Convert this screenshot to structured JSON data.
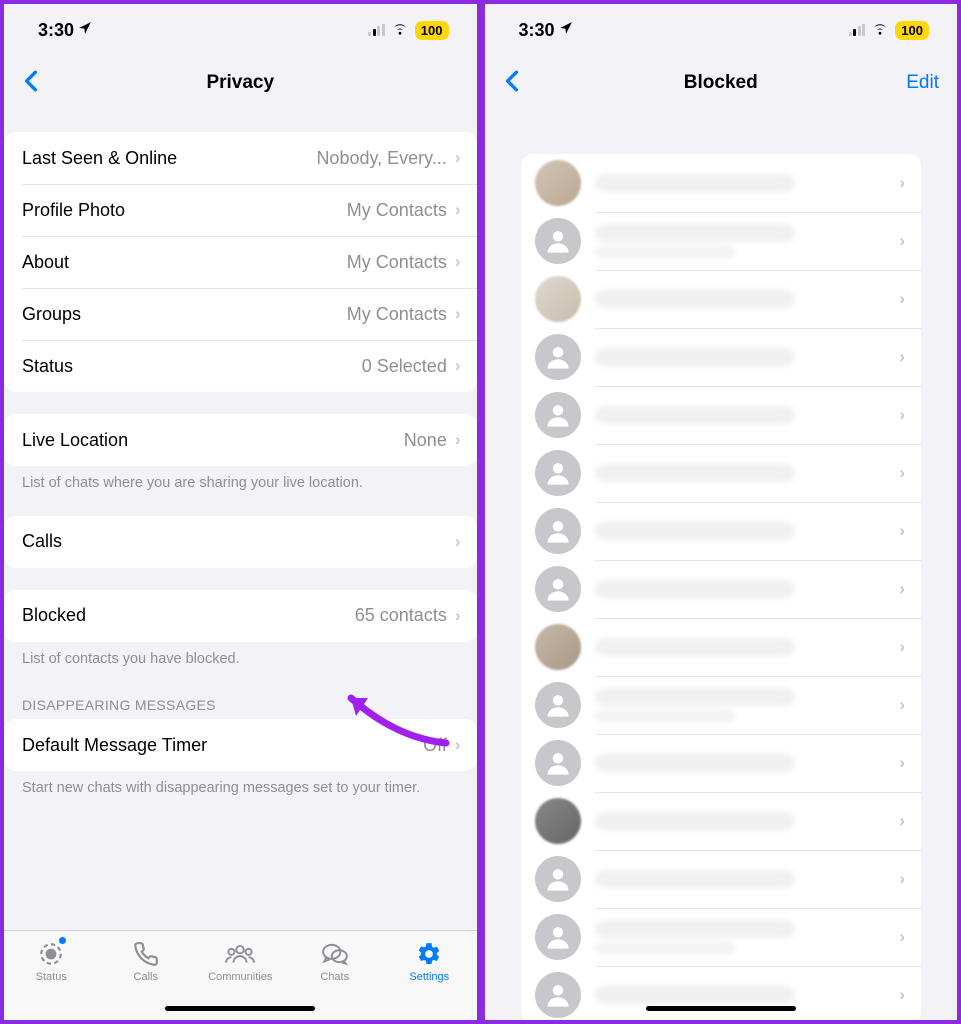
{
  "status_bar": {
    "time": "3:30",
    "battery": "100"
  },
  "left": {
    "title": "Privacy",
    "groups": {
      "g1": [
        {
          "label": "Last Seen & Online",
          "value": "Nobody, Every..."
        },
        {
          "label": "Profile Photo",
          "value": "My Contacts"
        },
        {
          "label": "About",
          "value": "My Contacts"
        },
        {
          "label": "Groups",
          "value": "My Contacts"
        },
        {
          "label": "Status",
          "value": "0 Selected"
        }
      ],
      "g2": [
        {
          "label": "Live Location",
          "value": "None"
        }
      ],
      "g2_note": "List of chats where you are sharing your live location.",
      "g3": [
        {
          "label": "Calls",
          "value": ""
        }
      ],
      "g4": [
        {
          "label": "Blocked",
          "value": "65 contacts"
        }
      ],
      "g4_note": "List of contacts you have blocked.",
      "g5_header": "DISAPPEARING MESSAGES",
      "g5": [
        {
          "label": "Default Message Timer",
          "value": "Off"
        }
      ],
      "g5_note": "Start new chats with disappearing messages set to your timer."
    },
    "tabs": {
      "status": "Status",
      "calls": "Calls",
      "communities": "Communities",
      "chats": "Chats",
      "settings": "Settings"
    }
  },
  "right": {
    "title": "Blocked",
    "edit": "Edit",
    "contacts_count": 15
  }
}
